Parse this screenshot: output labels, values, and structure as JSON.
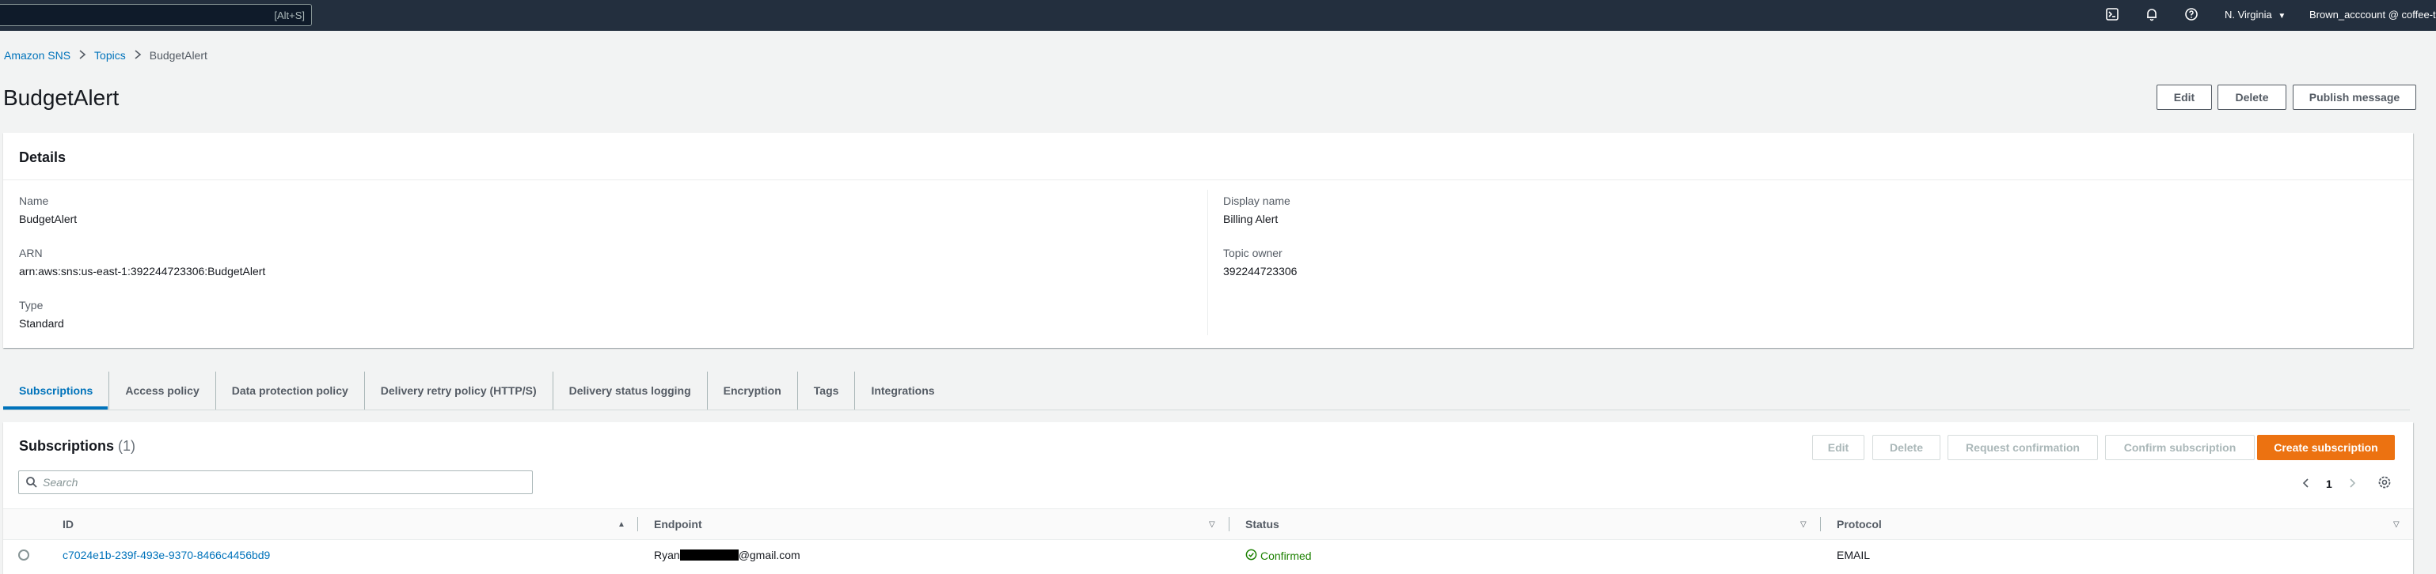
{
  "topnav": {
    "search_shortcut": "[Alt+S]",
    "region": "N. Virginia",
    "account": "Brown_acccount @ coffee-tal"
  },
  "icons": {
    "cloudshell": "terminal-icon",
    "notifications": "bell-icon",
    "help": "help-icon",
    "region_caret": "caret-down-icon"
  },
  "breadcrumb": {
    "items": [
      "Amazon SNS",
      "Topics"
    ],
    "current": "BudgetAlert"
  },
  "page": {
    "title": "BudgetAlert",
    "actions": {
      "edit": "Edit",
      "delete": "Delete",
      "publish": "Publish message"
    }
  },
  "details": {
    "header": "Details",
    "name_label": "Name",
    "name": "BudgetAlert",
    "arn_label": "ARN",
    "arn": "arn:aws:sns:us-east-1:392244723306:BudgetAlert",
    "type_label": "Type",
    "type": "Standard",
    "display_name_label": "Display name",
    "display_name": "Billing Alert",
    "owner_label": "Topic owner",
    "owner": "392244723306"
  },
  "tabs": [
    "Subscriptions",
    "Access policy",
    "Data protection policy",
    "Delivery retry policy (HTTP/S)",
    "Delivery status logging",
    "Encryption",
    "Tags",
    "Integrations"
  ],
  "subscriptions": {
    "title": "Subscriptions",
    "count": "(1)",
    "actions": {
      "edit": "Edit",
      "delete": "Delete",
      "request": "Request confirmation",
      "confirm": "Confirm subscription",
      "create": "Create subscription"
    },
    "search_placeholder": "Search",
    "page": "1",
    "columns": [
      "ID",
      "Endpoint",
      "Status",
      "Protocol"
    ],
    "rows": [
      {
        "id": "c7024e1b-239f-493e-9370-8466c4456bd9",
        "endpoint_prefix": "Ryan",
        "endpoint_suffix": "@gmail.com",
        "status": "Confirmed",
        "protocol": "EMAIL"
      }
    ]
  },
  "colors": {
    "nav_bg": "#232f3e",
    "link": "#0073bb",
    "primary": "#ec7211",
    "success": "#1d8102"
  }
}
